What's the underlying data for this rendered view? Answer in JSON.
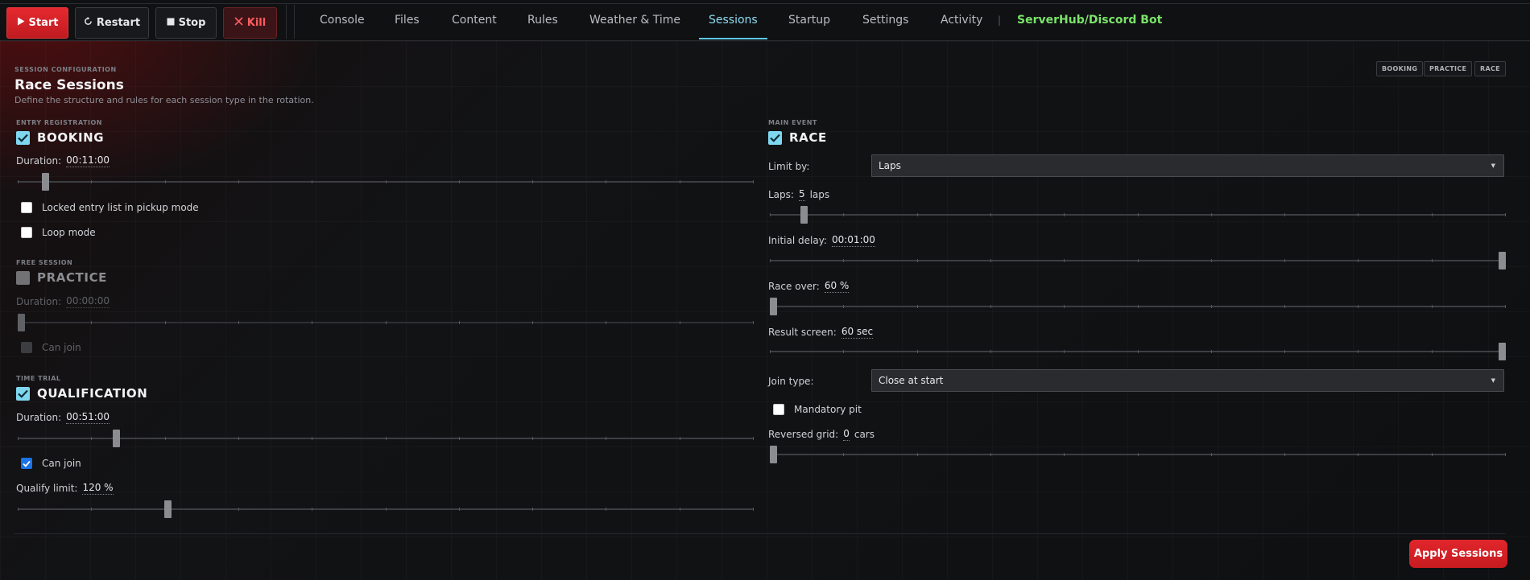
{
  "toolbar": {
    "start_label": "Start",
    "restart_label": "Restart",
    "stop_label": "Stop",
    "kill_label": "Kill"
  },
  "nav": {
    "tabs": [
      "Console",
      "Files",
      "Content",
      "Rules",
      "Weather & Time",
      "Sessions",
      "Startup",
      "Settings",
      "Activity"
    ],
    "active_tab": "Sessions",
    "divider": "|",
    "bot_link": "ServerHub/Discord Bot"
  },
  "header": {
    "eyebrow": "SESSION CONFIGURATION",
    "title": "Race Sessions",
    "subtitle": "Define the structure and rules for each session type in the rotation.",
    "chips": [
      "BOOKING",
      "PRACTICE",
      "RACE"
    ]
  },
  "booking": {
    "eyebrow": "ENTRY REGISTRATION",
    "name": "BOOKING",
    "enabled": true,
    "duration_label": "Duration:",
    "duration_value": "00:11:00",
    "duration_fraction": 0.037,
    "locked_label": "Locked entry list in pickup mode",
    "locked_checked": false,
    "loop_label": "Loop mode",
    "loop_checked": false
  },
  "practice": {
    "eyebrow": "FREE SESSION",
    "name": "PRACTICE",
    "enabled": false,
    "duration_label": "Duration:",
    "duration_value": "00:00:00",
    "duration_fraction": 0.0,
    "can_join_label": "Can join",
    "can_join_checked": false
  },
  "qualification": {
    "eyebrow": "TIME TRIAL",
    "name": "QUALIFICATION",
    "enabled": true,
    "duration_label": "Duration:",
    "duration_value": "00:51:00",
    "duration_fraction": 0.133,
    "can_join_label": "Can join",
    "can_join_checked": true,
    "qualify_limit_label": "Qualify limit:",
    "qualify_limit_value": "120 %",
    "qualify_limit_fraction": 0.203
  },
  "race": {
    "eyebrow": "MAIN EVENT",
    "name": "RACE",
    "enabled": true,
    "limit_by_label": "Limit by:",
    "limit_by_value": "Laps",
    "laps_label": "Laps:",
    "laps_value": "5",
    "laps_unit": "laps",
    "laps_fraction": 0.046,
    "initial_delay_label": "Initial delay:",
    "initial_delay_value": "00:01:00",
    "initial_delay_fraction": 0.997,
    "race_over_label": "Race over:",
    "race_over_value": "60 %",
    "race_over_fraction": 0.0,
    "result_screen_label": "Result screen:",
    "result_screen_value": "60 sec",
    "result_screen_fraction": 0.997,
    "join_type_label": "Join type:",
    "join_type_value": "Close at start",
    "mandatory_pit_label": "Mandatory pit",
    "mandatory_pit_checked": false,
    "reversed_grid_label": "Reversed grid:",
    "reversed_grid_value": "0",
    "reversed_grid_unit": "cars",
    "reversed_grid_fraction": 0.0
  },
  "footer": {
    "apply_label": "Apply Sessions"
  },
  "colors": {
    "accent_red": "#e1262c",
    "accent_cyan": "#7fd6ef",
    "bot_green": "#7be36a"
  }
}
